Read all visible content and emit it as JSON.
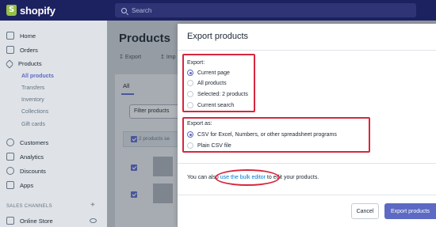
{
  "topbar": {
    "brand": "shopify",
    "search_placeholder": "Search"
  },
  "sidebar": {
    "items": [
      {
        "label": "Home",
        "icon": "home-icon"
      },
      {
        "label": "Orders",
        "icon": "orders-icon"
      },
      {
        "label": "Products",
        "icon": "tag-icon"
      },
      {
        "label": "Customers",
        "icon": "customers-icon"
      },
      {
        "label": "Analytics",
        "icon": "analytics-icon"
      },
      {
        "label": "Discounts",
        "icon": "discounts-icon"
      },
      {
        "label": "Apps",
        "icon": "apps-icon"
      }
    ],
    "product_subitems": [
      "All products",
      "Transfers",
      "Inventory",
      "Collections",
      "Gift cards"
    ],
    "sales_channels_label": "SALES CHANNELS",
    "sales_channels": [
      {
        "label": "Online Store"
      }
    ]
  },
  "page": {
    "title": "Products",
    "actions": [
      "Export",
      "Imp"
    ],
    "tabs": [
      "All"
    ],
    "filter_button": "Filter products",
    "selection_text": "2 products se"
  },
  "modal": {
    "title": "Export products",
    "export_label": "Export:",
    "export_options": [
      {
        "label": "Current page",
        "checked": true
      },
      {
        "label": "All products",
        "checked": false
      },
      {
        "label": "Selected: 2 products",
        "checked": false
      },
      {
        "label": "Current search",
        "checked": false
      }
    ],
    "export_as_label": "Export as:",
    "export_as_options": [
      {
        "label": "CSV for Excel, Numbers, or other spreadsheet programs",
        "checked": true
      },
      {
        "label": "Plain CSV file",
        "checked": false
      }
    ],
    "note_before": "You can also ",
    "note_link": "use the bulk editor",
    "note_after": " to edit your products.",
    "cancel_label": "Cancel",
    "primary_label": "Export products"
  },
  "colors": {
    "topbar": "#1c2260",
    "accent": "#5c6ac4",
    "highlight": "#d7263d",
    "link": "#007ace"
  }
}
